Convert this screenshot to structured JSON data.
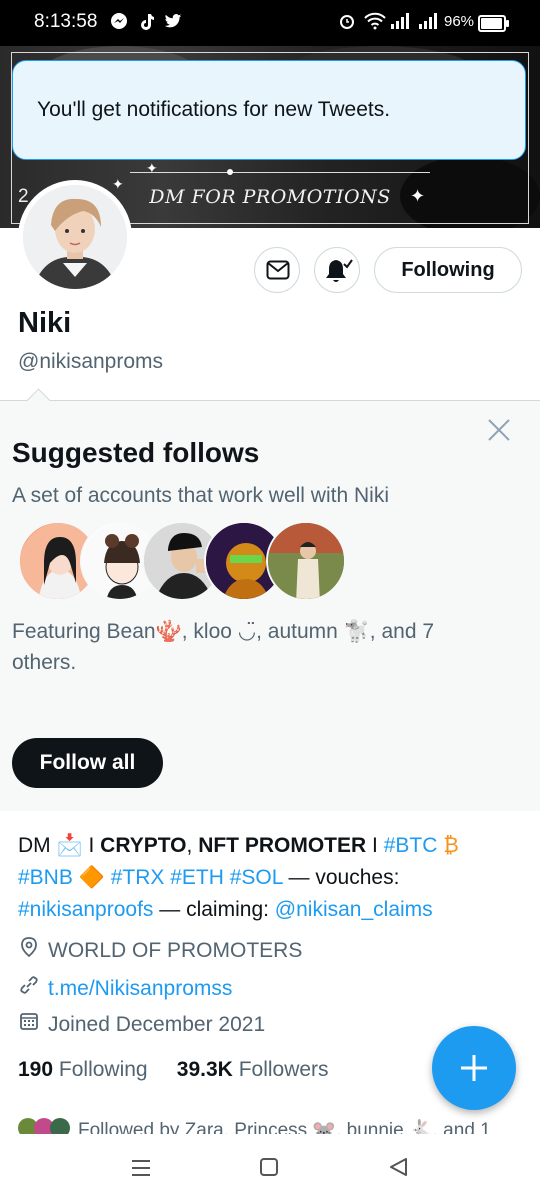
{
  "status_bar": {
    "time": "8:13:58",
    "battery_text": "96%",
    "battery_level": 0.96,
    "icons": [
      "messenger-icon",
      "tiktok-icon",
      "twitter-icon",
      "alarm-icon",
      "wifi-icon",
      "signal-icon",
      "signal-icon"
    ]
  },
  "banner": {
    "promo_text": "DM FOR PROMOTIONS",
    "corner_text": "2"
  },
  "toast": {
    "message": "You'll get notifications for new Tweets."
  },
  "profile": {
    "name": "Niki",
    "handle": "@nikisanproms",
    "following_button": "Following"
  },
  "suggested": {
    "title": "Suggested follows",
    "subtitle": "A set of accounts that work well with Niki",
    "featuring": "Featuring Bean🪸, kloo ◡̈, autumn 🐩, and 7 others.",
    "follow_all": "Follow all"
  },
  "bio": {
    "dm": "DM 📩 I ",
    "crypto": "CRYPTO",
    "comma": ", ",
    "nft": "NFT PROMOTER",
    "sep": " I ",
    "btc": "#BTC",
    "btc_emoji": " ₿",
    "bnb": "#BNB",
    "bnb_emoji": " 🔶 ",
    "trx": "#TRX",
    "eth": "#ETH",
    "sol": "#SOL",
    "vouches": " — vouches:",
    "proofs": "#nikisanproofs",
    "claiming": " — claiming: ",
    "claims": "@nikisan_claims"
  },
  "meta": {
    "location": "WORLD OF PROMOTERS",
    "url": "t.me/Nikisanpromss",
    "joined": "Joined December 2021"
  },
  "counts": {
    "following_num": "190",
    "following_label": "Following",
    "followers_num": "39.3K",
    "followers_label": "Followers"
  },
  "followed_by": "Followed by Zara, Princess 🐭, bunnie 🐇, and 1",
  "fab": {
    "label": "+"
  },
  "colors": {
    "accent": "#1d9bf0",
    "text": "#0f1419",
    "muted": "#536471"
  }
}
